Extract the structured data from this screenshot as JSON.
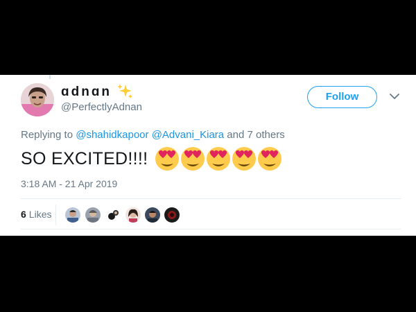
{
  "tweet": {
    "display_name": "ɑdnɑn",
    "display_name_emoji_icon": "sparkles-icon",
    "handle": "@PerfectlyAdnan",
    "follow_label": "Follow",
    "replying_prefix": "Replying to ",
    "replying_mention_1": "@shahidkapoor",
    "replying_mention_2": "@Advani_Kiara",
    "replying_suffix": " and 7 others",
    "text": "SO EXCITED!!!!",
    "emoji_icon": "heart-eyes-emoji-icon",
    "emoji_count": 5,
    "timestamp": "3:18 AM - 21 Apr 2019",
    "likes_count": "6",
    "likes_label": "Likes",
    "liker_count": 6
  },
  "colors": {
    "accent": "#1da1f2",
    "link": "#1b95e0",
    "secondary_text": "#657786",
    "primary_text": "#14171a",
    "background": "#000000",
    "card": "#ffffff"
  }
}
